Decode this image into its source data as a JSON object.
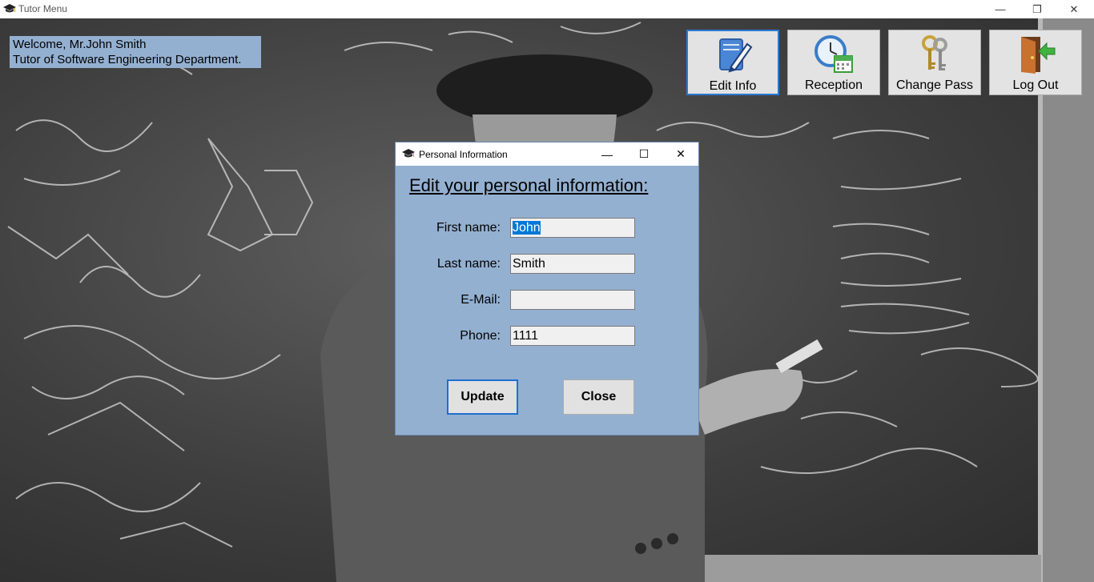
{
  "window": {
    "title": "Tutor Menu",
    "controls": {
      "minimize": "—",
      "maximize": "❐",
      "close": "✕"
    }
  },
  "welcome": {
    "line1": "Welcome, Mr.John Smith",
    "line2": "Tutor of Software Engineering Department."
  },
  "toolbar": {
    "buttons": [
      {
        "label": "Edit Info",
        "icon": "edit-document-icon",
        "active": true
      },
      {
        "label": "Reception",
        "icon": "clock-calendar-icon",
        "active": false
      },
      {
        "label": "Change Pass",
        "icon": "keys-icon",
        "active": false
      },
      {
        "label": "Log Out",
        "icon": "door-exit-icon",
        "active": false
      }
    ]
  },
  "dialog": {
    "title": "Personal Information",
    "controls": {
      "minimize": "—",
      "maximize": "☐",
      "close": "✕"
    },
    "heading": "Edit your personal information:",
    "fields": {
      "first_name": {
        "label": "First name:",
        "value": "John"
      },
      "last_name": {
        "label": "Last name:",
        "value": "Smith"
      },
      "email": {
        "label": "E-Mail:",
        "value": ""
      },
      "phone": {
        "label": "Phone:",
        "value": "1111"
      }
    },
    "update_label": "Update",
    "close_label": "Close"
  },
  "colors": {
    "panel": "#94b0d1",
    "accent": "#2a78d2",
    "selection": "#0078d7"
  }
}
